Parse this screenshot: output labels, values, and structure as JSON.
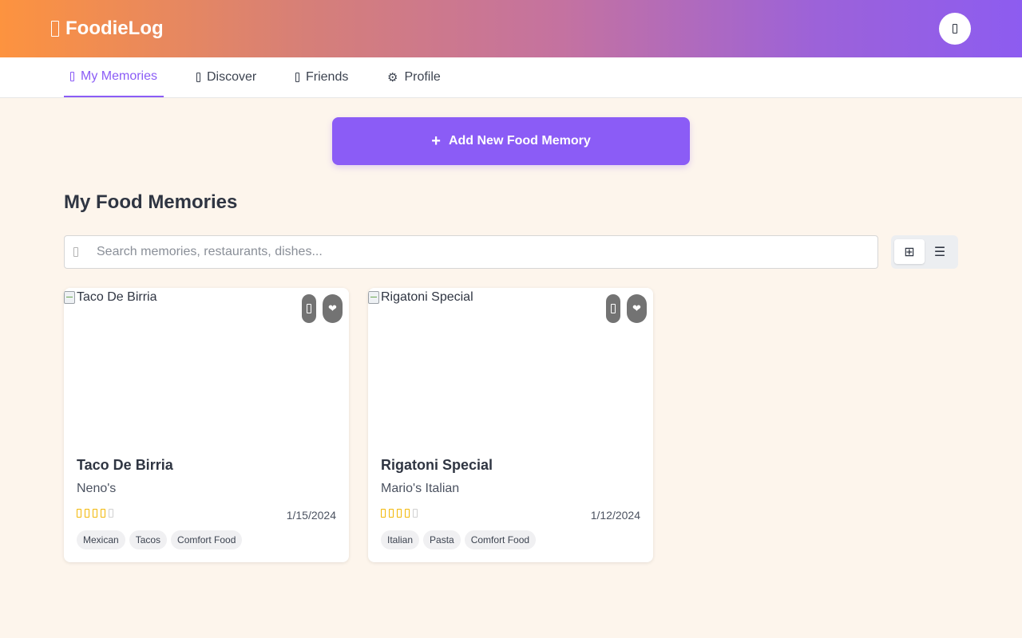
{
  "app": {
    "title": "FoodieLog",
    "logo_icon": "food-icon",
    "header_button_icon": "user-icon"
  },
  "nav": {
    "items": [
      {
        "label": "My Memories",
        "icon": "book-icon",
        "active": true
      },
      {
        "label": "Discover",
        "icon": "compass-icon",
        "active": false
      },
      {
        "label": "Friends",
        "icon": "users-icon",
        "active": false
      },
      {
        "label": "Profile",
        "icon": "gear-icon",
        "glyph": "⚙",
        "active": false
      }
    ]
  },
  "actions": {
    "add_label": "Add New Food Memory",
    "add_glyph": "+"
  },
  "main": {
    "section_title": "My Food Memories"
  },
  "search": {
    "placeholder": "Search memories, restaurants, dishes...",
    "value": ""
  },
  "view_toggle": {
    "grid_glyph": "⊞",
    "list_glyph": "☰",
    "selected": "grid"
  },
  "memories": [
    {
      "image_alt": "Taco De Birria",
      "title": "Taco De Birria",
      "restaurant": "Neno's",
      "rating": 4,
      "rating_max": 5,
      "date": "1/15/2024",
      "tags": [
        "Mexican",
        "Tacos",
        "Comfort Food"
      ],
      "heart_glyph": "❤"
    },
    {
      "image_alt": "Rigatoni Special",
      "title": "Rigatoni Special",
      "restaurant": "Mario's Italian",
      "rating": 4,
      "rating_max": 5,
      "date": "1/12/2024",
      "tags": [
        "Italian",
        "Pasta",
        "Comfort Food"
      ],
      "heart_glyph": "❤"
    }
  ],
  "colors": {
    "accent": "#8b5cf6",
    "header_gradient_start": "#fd933f",
    "header_gradient_end": "#8d5cf0",
    "page_background": "#fdf5ec",
    "star": "#f2b705"
  }
}
